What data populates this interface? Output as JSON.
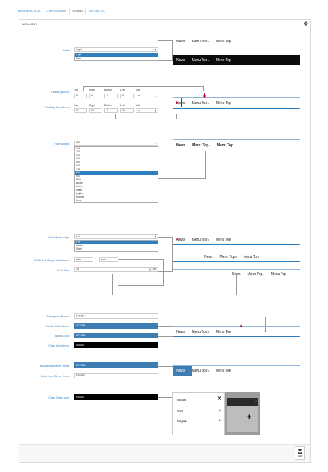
{
  "tabs": [
    {
      "label": "MEGA MENU PLUS",
      "active": false
    },
    {
      "label": "CONFIGURATION",
      "active": false
    },
    {
      "label": "STYLING",
      "active": true
    },
    {
      "label": "CUSTOM CSS",
      "active": false
    }
  ],
  "panel": {
    "title": "MENU BAR",
    "icon": "gear-icon"
  },
  "style": {
    "label": "Style:",
    "value": "Light",
    "options": [
      "Light",
      "Dark"
    ],
    "highlighted": "Light"
  },
  "padding": {
    "menu_label": "Padding Menu:",
    "item_label": "Padding Item Menu:",
    "headers": [
      "Top",
      "Right",
      "Bottom",
      "Left",
      "Unit"
    ],
    "menu_values": [
      "5",
      "0",
      "0",
      "0",
      "px"
    ],
    "item_values": [
      "0",
      "10",
      "0",
      "10",
      "px"
    ]
  },
  "font_weight": {
    "label": "Font Weight:",
    "value": "800",
    "options": [
      "100",
      "200",
      "300",
      "400",
      "500",
      "600",
      "700",
      "800",
      "900",
      "Bold",
      "Bolder",
      "Inherit",
      "Initial",
      "Lighter",
      "Normal",
      "Unset"
    ],
    "highlighted": "800"
  },
  "align": {
    "label": "Menu Items Align:",
    "value": "Left",
    "options": [
      "Left",
      "Center",
      "Right"
    ],
    "highlighted": "Left"
  },
  "size": {
    "label": "Width And Height Item Menu:",
    "width": "auto",
    "sep": "*",
    "height": "auto"
  },
  "font_size": {
    "label": "Font Size:",
    "value": "16",
    "unit": "Px"
  },
  "colors": {
    "background_menu": {
      "label": "Background Menu:",
      "value": "FFFFFF",
      "swatch": "#ffffff",
      "text": "#333333"
    },
    "border_color": {
      "label": "Border Color Menu:",
      "value": "3E7CB4",
      "swatch": "#3e7cb4",
      "text": "#ffffff"
    },
    "arrow_color": {
      "label": "Arrow Color:",
      "value": "3E7CB4",
      "swatch": "#3e7cb4",
      "text": "#ffffff"
    },
    "color_item": {
      "label": "Color Item Menu:",
      "value": "000000",
      "swatch": "#000000",
      "text": "#ffffff"
    },
    "bg_item_hover": {
      "label": "Background Item Hover:",
      "value": "3E7CB4",
      "swatch": "#3e7cb4",
      "text": "#ffffff"
    },
    "color_item_hover": {
      "label": "Color Item Menu Hover:",
      "value": "FFFFFF",
      "swatch": "#ffffff",
      "text": "#333333"
    },
    "color_close_icon": {
      "label": "Color Close Icon:",
      "value": "000000",
      "swatch": "#000000",
      "text": "#ffffff"
    }
  },
  "preview": {
    "news": "News",
    "menu_top": "Menu Top",
    "menu_top2": "Menu Top"
  },
  "mobile": {
    "title": "MENU",
    "close": "✕",
    "items": [
      {
        "label": "Sad",
        "icon": "+"
      },
      {
        "label": "Mega1",
        "icon": "+"
      }
    ],
    "plus": "+"
  },
  "footer": {
    "save": "Save"
  },
  "accent": "#2f7fc1"
}
